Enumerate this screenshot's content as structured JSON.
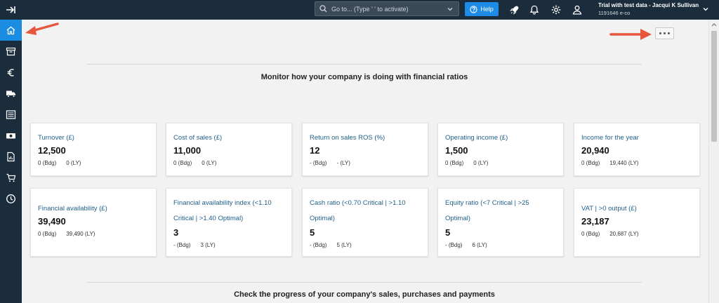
{
  "header": {
    "search_placeholder": "Go to... (Type ' ' to activate)",
    "help_label": "Help",
    "account_title": "Trial with test data - Jacqui K Sullivan",
    "account_sub": "1191646 e-co"
  },
  "sidebar": {
    "items": [
      "home-icon",
      "archive-icon",
      "euro-icon",
      "truck-icon",
      "list-icon",
      "cash-icon",
      "report-icon",
      "cart-icon",
      "clock-icon"
    ],
    "active_color": "#1a8de3"
  },
  "main": {
    "section1_title": "Monitor how your company is doing with financial ratios",
    "section2_title": "Check the progress of your company's sales, purchases and payments",
    "cards": [
      {
        "title": "Turnover (£)",
        "value": "12,500",
        "bdg": "0 (Bdg)",
        "ly": "0 (LY)"
      },
      {
        "title": "Cost of sales (£)",
        "value": "11,000",
        "bdg": "0 (Bdg)",
        "ly": "0 (LY)"
      },
      {
        "title": "Return on sales ROS (%)",
        "value": "12",
        "bdg": "- (Bdg)",
        "ly": "- (LY)"
      },
      {
        "title": "Operating income (£)",
        "value": "1,500",
        "bdg": "0 (Bdg)",
        "ly": "0 (LY)"
      },
      {
        "title": "Income for the year",
        "value": "20,940",
        "bdg": "0 (Bdg)",
        "ly": "19,440 (LY)"
      },
      {
        "title": "Financial availability (£)",
        "value": "39,490",
        "bdg": "0 (Bdg)",
        "ly": "39,490 (LY)"
      },
      {
        "title": "Financial availability index (<1.10 Critical | >1.40 Optimal)",
        "value": "3",
        "bdg": "- (Bdg)",
        "ly": "3 (LY)"
      },
      {
        "title": "Cash ratio (<0.70 Critical | >1.10 Optimal)",
        "value": "5",
        "bdg": "- (Bdg)",
        "ly": "5 (LY)"
      },
      {
        "title": "Equity ratio (<7 Critical | >25 Optimal)",
        "value": "5",
        "bdg": "- (Bdg)",
        "ly": "6 (LY)"
      },
      {
        "title": "VAT | >0 output (£)",
        "value": "23,187",
        "bdg": "0 (Bdg)",
        "ly": "20,687 (LY)"
      }
    ]
  },
  "colors": {
    "topbar": "#1b2d3d",
    "accent": "#1a8de3",
    "card_title": "#1f5f8b",
    "annotation_arrow": "#e8553d"
  }
}
